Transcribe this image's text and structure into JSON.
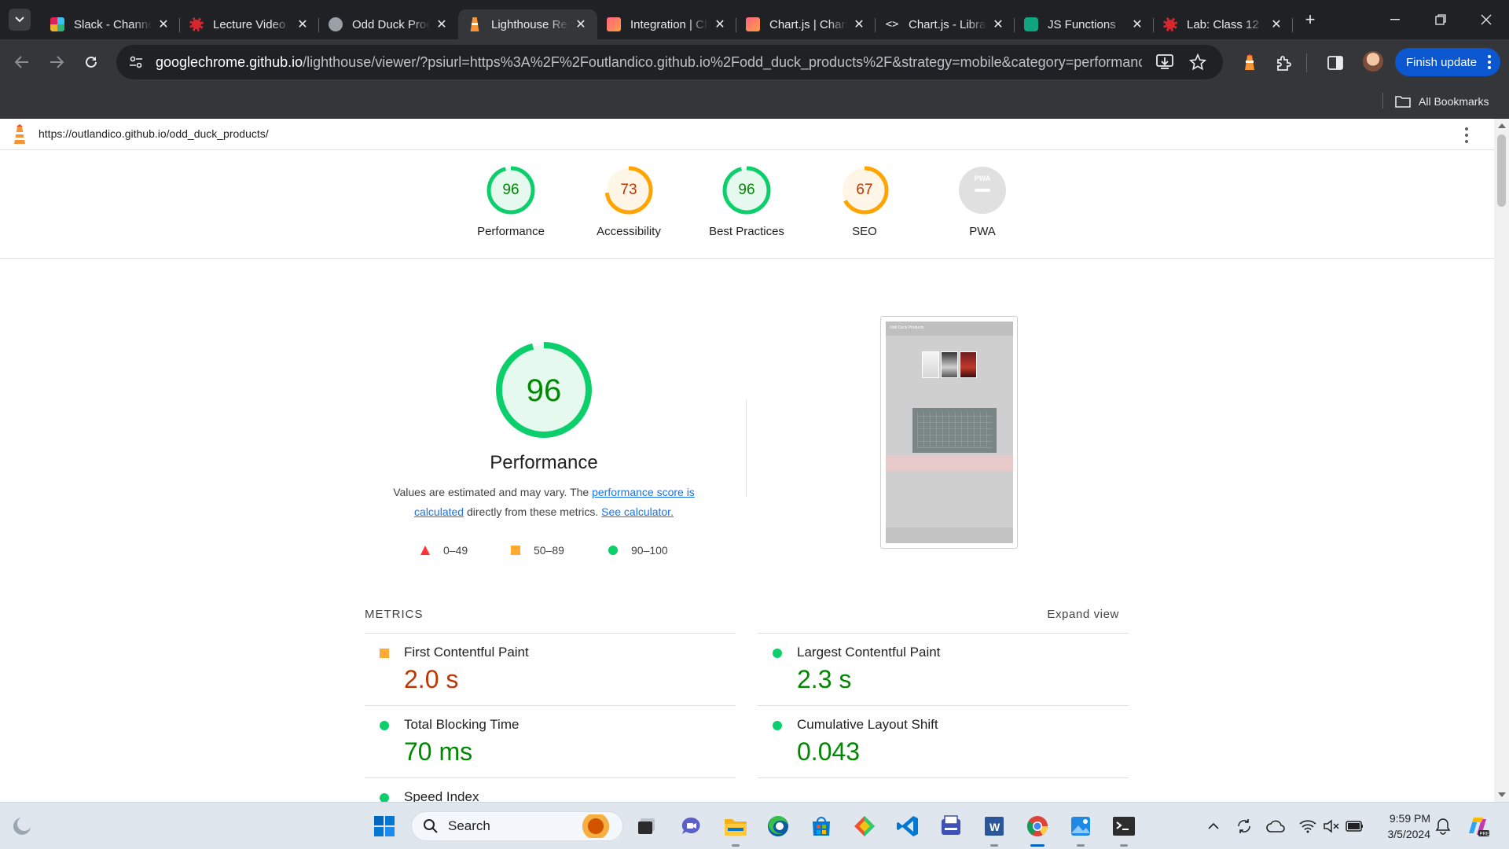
{
  "browser": {
    "tabs": [
      {
        "title": "Slack - Channel",
        "favicon": "slack-icon",
        "active": false
      },
      {
        "title": "Lecture Video",
        "favicon": "codefellows-icon",
        "active": false
      },
      {
        "title": "Odd Duck Products",
        "favicon": "github-icon",
        "active": false
      },
      {
        "title": "Lighthouse Report",
        "favicon": "lighthouse-icon",
        "active": true
      },
      {
        "title": "Integration | Chart.js",
        "favicon": "chartjs-icon",
        "active": false
      },
      {
        "title": "Chart.js | Chart.js",
        "favicon": "chartjs-icon",
        "active": false
      },
      {
        "title": "Chart.js - Library",
        "favicon": "code-icon",
        "active": false
      },
      {
        "title": "JS Functions",
        "favicon": "chatgpt-icon",
        "active": false
      },
      {
        "title": "Lab: Class 12",
        "favicon": "codefellows-icon",
        "active": false
      }
    ],
    "address": {
      "host": "googlechrome.github.io",
      "rest": "/lighthouse/viewer/?psiurl=https%3A%2F%2Foutlandico.github.io%2Fodd_duck_products%2F&strategy=mobile&category=performance&..."
    },
    "finish_update_label": "Finish update",
    "all_bookmarks_label": "All Bookmarks"
  },
  "report": {
    "url": "https://outlandico.github.io/odd_duck_products/",
    "categories": [
      {
        "label": "Performance",
        "score": "96",
        "status": "pass"
      },
      {
        "label": "Accessibility",
        "score": "73",
        "status": "average"
      },
      {
        "label": "Best Practices",
        "score": "96",
        "status": "pass"
      },
      {
        "label": "SEO",
        "score": "67",
        "status": "average"
      },
      {
        "label": "PWA",
        "score": "",
        "status": "na"
      }
    ],
    "perf": {
      "score": "96",
      "title": "Performance",
      "desc_before": "Values are estimated and may vary. The ",
      "desc_link1": "performance score is calculated",
      "desc_middle": " directly from these metrics. ",
      "desc_link2": "See calculator."
    },
    "legend": [
      {
        "range": "0–49",
        "shape": "triangle",
        "color": "#ff3333"
      },
      {
        "range": "50–89",
        "shape": "square",
        "color": "#ffaa33"
      },
      {
        "range": "90–100",
        "shape": "circle",
        "color": "#0cce6b"
      }
    ],
    "thumbnail_title": "Odd Duck Products",
    "metrics_title": "METRICS",
    "expand_label": "Expand view",
    "metrics": [
      {
        "name": "First Contentful Paint",
        "value": "2.0 s",
        "status": "average"
      },
      {
        "name": "Largest Contentful Paint",
        "value": "2.3 s",
        "status": "pass"
      },
      {
        "name": "Total Blocking Time",
        "value": "70 ms",
        "status": "pass"
      },
      {
        "name": "Cumulative Layout Shift",
        "value": "0.043",
        "status": "pass"
      },
      {
        "name": "Speed Index",
        "value": "",
        "status": "pass"
      }
    ]
  },
  "taskbar": {
    "search_placeholder": "Search",
    "time": "9:59 PM",
    "date": "3/5/2024"
  },
  "colors": {
    "pass": "#0cce6b",
    "average": "#ffa400",
    "fail": "#ff4e42",
    "accent": "#0b57d0"
  }
}
